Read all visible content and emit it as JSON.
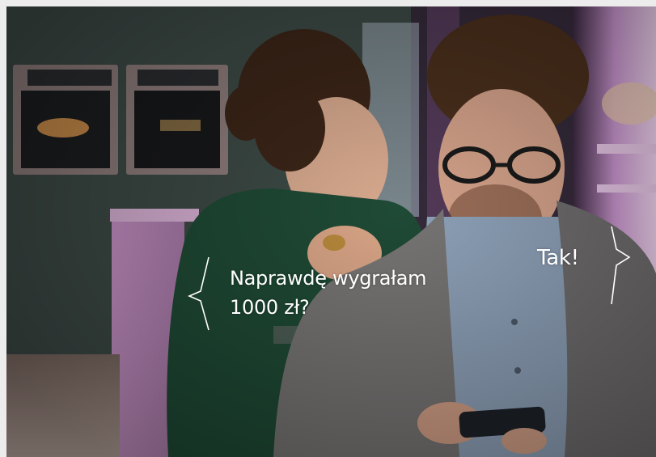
{
  "photo": {
    "alt_icon": "photo-scene",
    "colors": {
      "wall": "#3a4743",
      "oven_frame": "#8e7d7c",
      "green_sweater": "#1f4a35",
      "grey_cardigan": "#777574",
      "blue_shirt": "#8ea1b8",
      "skin": "#d7a98e",
      "hair_woman": "#3c2518",
      "hair_man": "#4a2f1c",
      "pink_light": "#d8a0d6",
      "floor": "#6c5a54"
    }
  },
  "speech": {
    "left_line1": "Naprawdę wygrałam",
    "left_line2": "1000 zł?",
    "right": "Tak!"
  }
}
